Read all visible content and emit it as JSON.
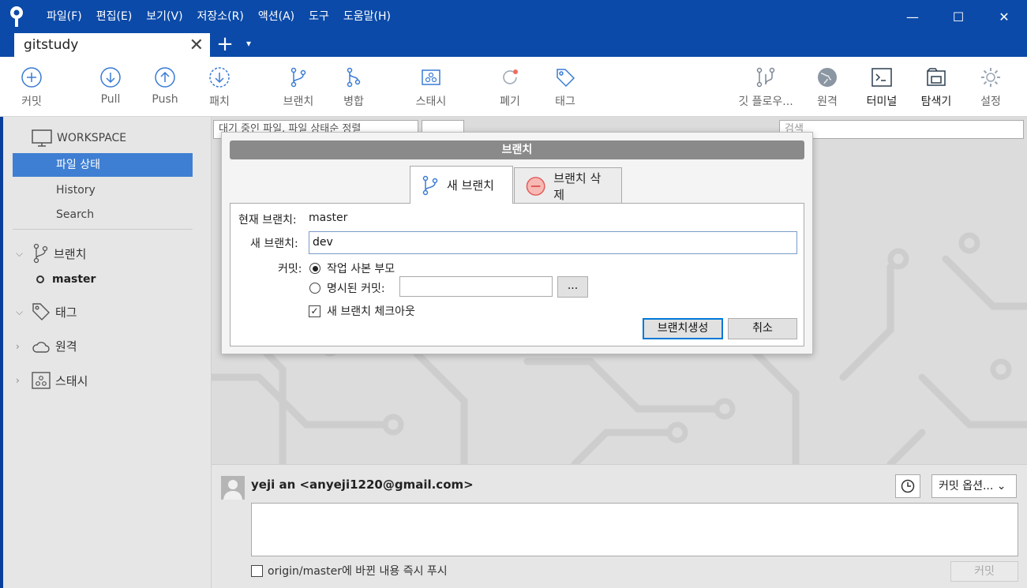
{
  "menu": {
    "items": [
      "파일(F)",
      "편집(E)",
      "보기(V)",
      "저장소(R)",
      "액션(A)",
      "도구",
      "도움말(H)"
    ]
  },
  "window_controls": {
    "minimize": "—",
    "maximize": "☐",
    "close": "✕"
  },
  "tabs": {
    "repo": "gitstudy",
    "close": "✕",
    "add": "+",
    "more": "▾"
  },
  "toolbar": {
    "commit": "커밋",
    "pull": "Pull",
    "push": "Push",
    "patch": "패치",
    "branch": "브랜치",
    "merge": "병합",
    "stash": "스태시",
    "discard": "폐기",
    "tag": "태그",
    "gitflow": "깃 플로우...",
    "remote": "원격",
    "terminal": "터미널",
    "explorer": "탐색기",
    "settings": "설정"
  },
  "sidebar": {
    "workspace": "WORKSPACE",
    "items": [
      "파일 상태",
      "History",
      "Search"
    ],
    "branches": "브랜치",
    "current_branch": "master",
    "tags": "태그",
    "remotes": "원격",
    "stashes": "스태시"
  },
  "main": {
    "filter": "대기 중인 파일, 파일 상태순 정렬",
    "search_placeholder": "검색"
  },
  "commit_area": {
    "author": "yeji an <anyeji1220@gmail.com>",
    "options": "커밋 옵션...",
    "push_label": "origin/master에 바뀐 내용 즉시 푸시",
    "commit_button": "커밋"
  },
  "dialog": {
    "title": "브랜치",
    "tab_new": "새 브랜치",
    "tab_delete": "브랜치 삭제",
    "current_branch_label": "현재 브랜치:",
    "current_branch_value": "master",
    "new_branch_label": "새 브랜치:",
    "new_branch_value": "dev",
    "commit_label": "커밋:",
    "option_working_copy": "작업 사본 부모",
    "option_specified": "명시된 커밋:",
    "specified_value": "",
    "browse_button": "...",
    "checkout_label": "새 브랜치 체크아웃",
    "checkout_checked": true,
    "create_button": "브랜치생성",
    "cancel_button": "취소"
  },
  "colors": {
    "title_bar": "#0b4aa8",
    "sidebar_selected": "#3f7fd3",
    "delete_icon": "#e05a5a",
    "primary_border": "#0078d7"
  }
}
